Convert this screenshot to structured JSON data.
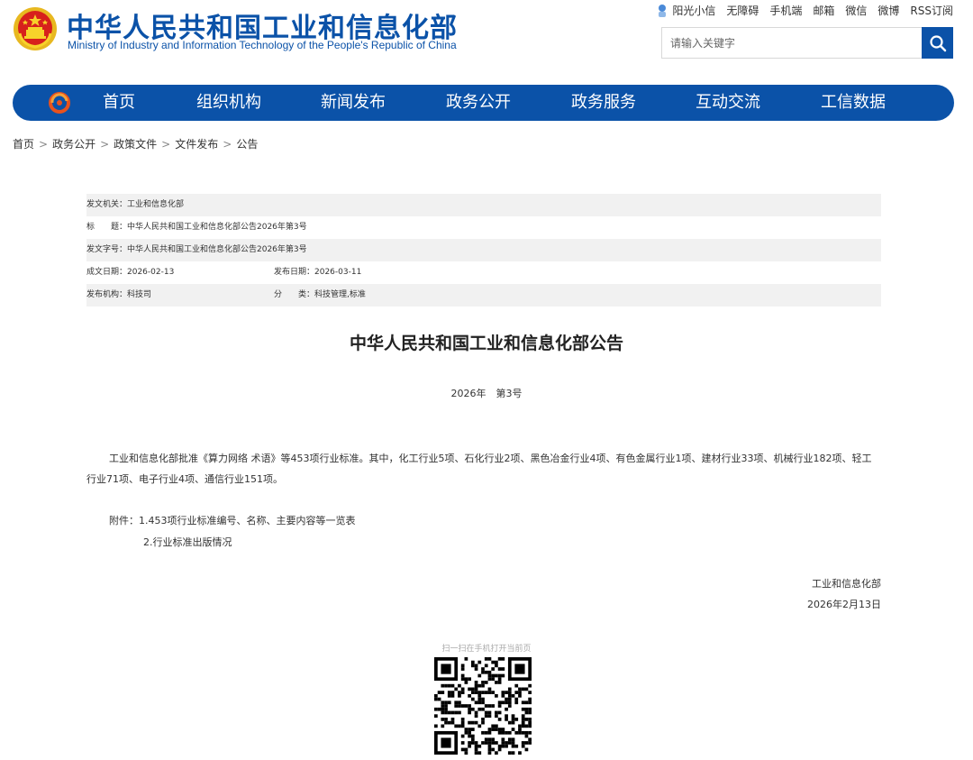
{
  "header": {
    "title": "中华人民共和国工业和信息化部",
    "subtitle": "Ministry of Industry and Information Technology of the People's Republic of China",
    "top_links": [
      "阳光小信",
      "无障碍",
      "手机端",
      "邮箱",
      "微信",
      "微博",
      "RSS订阅"
    ],
    "search_placeholder": "请输入关键字"
  },
  "nav": {
    "items": [
      "首页",
      "组织机构",
      "新闻发布",
      "政务公开",
      "政务服务",
      "互动交流",
      "工信数据"
    ]
  },
  "breadcrumb": [
    "首页",
    "政务公开",
    "政策文件",
    "文件发布",
    "公告"
  ],
  "meta": {
    "issuer": "发文机关：工业和信息化部",
    "title": "标　　题：中华人民共和国工业和信息化部公告2026年第3号",
    "doc_no": "发文字号：中华人民共和国工业和信息化部公告2026年第3号",
    "created": "成文日期：2026-02-13",
    "published": "发布日期：2026-03-11",
    "org": "发布机构：科技司",
    "category": "分　　类：科技管理,标准"
  },
  "article": {
    "title": "中华人民共和国工业和信息化部公告",
    "number": "2026年　第3号",
    "body": "工业和信息化部批准《算力网络 术语》等453项行业标准。其中，化工行业5项、石化行业2项、黑色冶金行业4项、有色金属行业1项、建材行业33项、机械行业182项、轻工行业71项、电子行业4项、通信行业151项。",
    "attachment_1": "附件：1.453项行业标准编号、名称、主要内容等一览表",
    "attachment_2": "2.行业标准出版情况",
    "sign_org": "工业和信息化部",
    "sign_date": "2026年2月13日"
  },
  "qr": {
    "label": "扫一扫在手机打开当前页"
  },
  "colors": {
    "brand_blue": "#0b52a8",
    "meta_shade": "#f1f1f1"
  }
}
